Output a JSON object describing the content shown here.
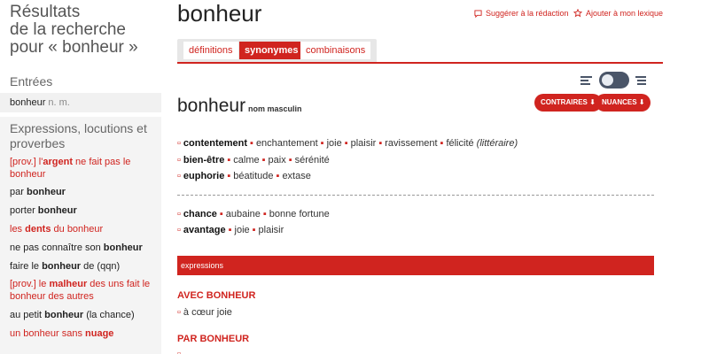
{
  "sidebar": {
    "title_lines": [
      "Résultats",
      "de la recherche",
      "pour « bonheur »"
    ],
    "entries_heading": "Entrées",
    "entry": {
      "word": "bonheur",
      "pos": "n. m."
    },
    "expressions_heading_lines": [
      "Expressions, locutions et",
      "proverbes"
    ],
    "expressions": [
      {
        "lines": [
          [
            {
              "t": "[prov.] l'"
            },
            {
              "t": "argent",
              "b": true
            },
            {
              "t": " ne fait pas le"
            }
          ],
          [
            {
              "t": "bonheur"
            }
          ]
        ],
        "red": true
      },
      {
        "lines": [
          [
            {
              "t": "par "
            },
            {
              "t": "bonheur",
              "b": true
            }
          ]
        ],
        "red": false
      },
      {
        "lines": [
          [
            {
              "t": "porter "
            },
            {
              "t": "bonheur",
              "b": true
            }
          ]
        ],
        "red": false
      },
      {
        "lines": [
          [
            {
              "t": "les "
            },
            {
              "t": "dents",
              "b": true
            },
            {
              "t": " du bonheur"
            }
          ]
        ],
        "red": true
      },
      {
        "lines": [
          [
            {
              "t": "ne pas connaître son "
            },
            {
              "t": "bonheur",
              "b": true
            }
          ]
        ],
        "red": false
      },
      {
        "lines": [
          [
            {
              "t": "faire le "
            },
            {
              "t": "bonheur",
              "b": true
            },
            {
              "t": " de (qqn)"
            }
          ]
        ],
        "red": false
      },
      {
        "lines": [
          [
            {
              "t": "[prov.] le "
            },
            {
              "t": "malheur",
              "b": true
            },
            {
              "t": " des uns fait le"
            }
          ],
          [
            {
              "t": "bonheur des autres"
            }
          ]
        ],
        "red": true
      },
      {
        "lines": [
          [
            {
              "t": "au petit "
            },
            {
              "t": "bonheur",
              "b": true
            },
            {
              "t": " (la chance)"
            }
          ]
        ],
        "red": false
      },
      {
        "lines": [
          [
            {
              "t": "un bonheur sans "
            },
            {
              "t": "nuage",
              "b": true
            }
          ]
        ],
        "red": true
      }
    ]
  },
  "header": {
    "word": "bonheur",
    "suggest_label": "Suggérer à la rédaction",
    "add_label": "Ajouter à mon lexique"
  },
  "tabs": [
    {
      "label": "définitions",
      "active": false
    },
    {
      "label": "synonymes",
      "active": true
    },
    {
      "label": "combinaisons",
      "active": false
    }
  ],
  "entry": {
    "word": "bonheur",
    "grammar": "nom masculin",
    "contraires_label": "CONTRAIRES ⬇",
    "nuances_label": "NUANCES ⬇"
  },
  "synonyms": [
    {
      "lead": "contentement",
      "items": [
        "enchantement",
        "joie",
        "plaisir",
        "ravissement",
        "félicité"
      ],
      "note": "(littéraire)"
    },
    {
      "lead": "bien-être",
      "items": [
        "calme",
        "paix",
        "sérénité"
      ]
    },
    {
      "lead": "euphorie",
      "items": [
        "béatitude",
        "extase"
      ]
    },
    {
      "lead": "chance",
      "items": [
        "aubaine",
        "bonne fortune"
      ]
    },
    {
      "lead": "avantage",
      "items": [
        "joie",
        "plaisir"
      ]
    }
  ],
  "expressions_section": {
    "bar_label": "expressions",
    "groups": [
      {
        "heading": "AVEC BONHEUR",
        "items": [
          "à cœur joie"
        ]
      },
      {
        "heading": "PAR BONHEUR",
        "items": [
          "…"
        ]
      }
    ]
  },
  "colors": {
    "accent": "#d0241f",
    "toggle": "#4a5568",
    "tab_bar": "#e7e7e7"
  },
  "icons": [
    "comment-icon",
    "star-icon",
    "list-compact-icon",
    "list-expanded-icon"
  ]
}
